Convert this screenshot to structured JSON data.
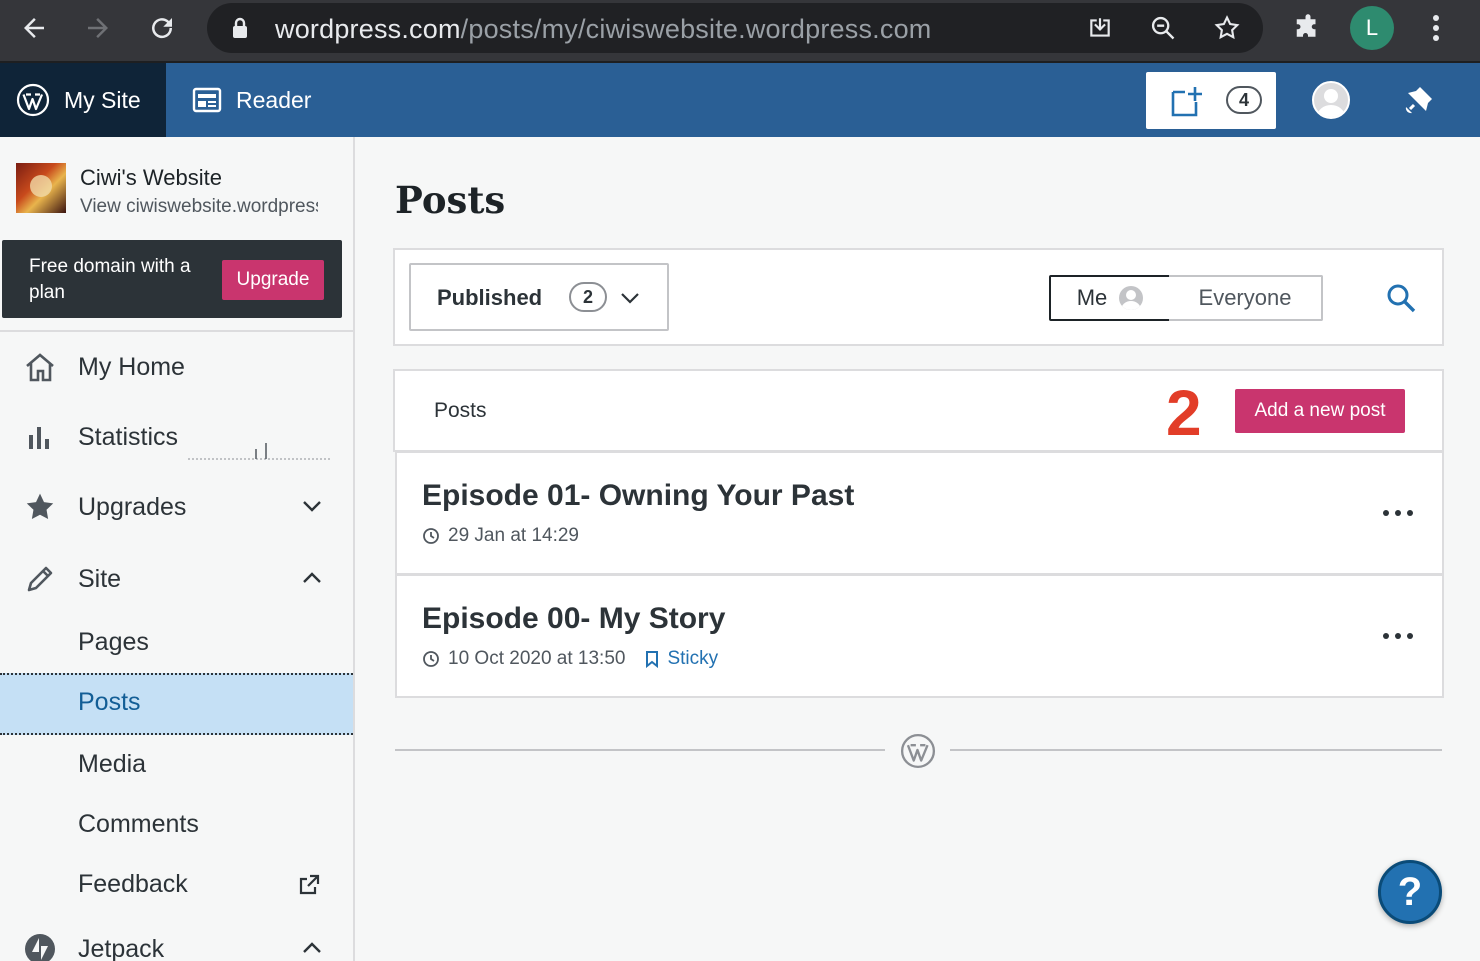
{
  "browser": {
    "url_host": "wordpress.com",
    "url_path": "/posts/my/ciwiswebsite.wordpress.com",
    "profile_initial": "L"
  },
  "masterbar": {
    "my_site_label": "My Site",
    "reader_label": "Reader",
    "drafts_count": "4"
  },
  "sidebar": {
    "site_name": "Ciwi's Website",
    "site_url": "View ciwiswebsite.wordpress.com",
    "upsell_text": "Free domain with a plan",
    "upsell_button": "Upgrade",
    "items": [
      {
        "label": "My Home",
        "icon": "home-icon"
      },
      {
        "label": "Statistics",
        "icon": "stats-icon"
      },
      {
        "label": "Upgrades",
        "icon": "star-icon"
      },
      {
        "label": "Site",
        "icon": "pencil-icon"
      },
      {
        "label": "Jetpack",
        "icon": "jetpack-icon"
      }
    ],
    "sub_items": [
      "Pages",
      "Posts",
      "Media",
      "Comments",
      "Feedback"
    ]
  },
  "main": {
    "page_title": "Posts",
    "status_filter": {
      "label": "Published",
      "count": "2"
    },
    "author_toggle": {
      "me": "Me",
      "everyone": "Everyone"
    },
    "list_header": "Posts",
    "annotation": "2",
    "add_button": "Add a new post",
    "posts": [
      {
        "title": "Episode 01- Owning Your Past",
        "date": "29 Jan at 14:29",
        "sticky": ""
      },
      {
        "title": "Episode 00- My Story",
        "date": "10 Oct 2020 at 13:50",
        "sticky": "Sticky"
      }
    ],
    "help": "?"
  },
  "colors": {
    "masterbar": "#2a5f95",
    "accent_pink": "#c9356e",
    "link_blue": "#2271b1",
    "annotation_red": "#e23d28"
  }
}
